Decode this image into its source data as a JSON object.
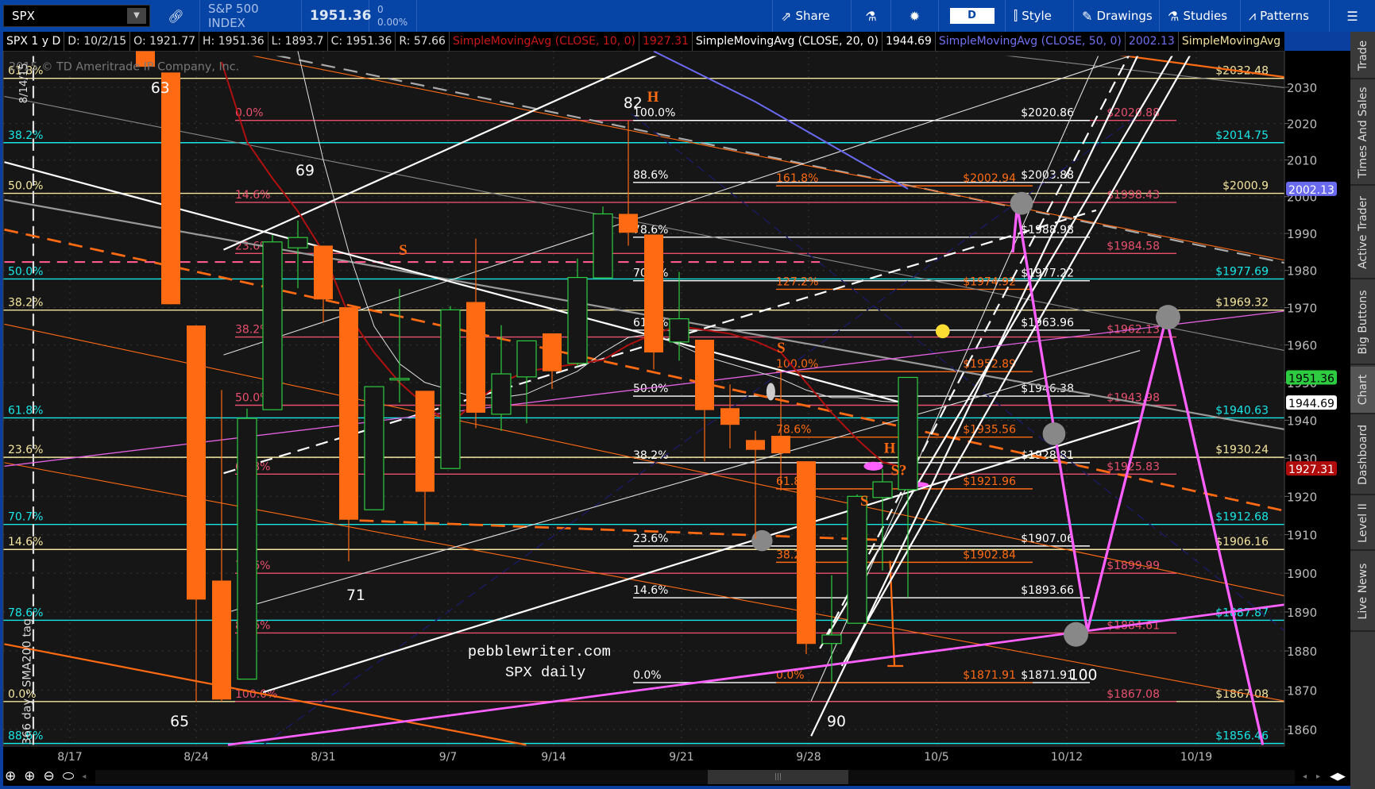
{
  "toolbar": {
    "symbol": "SPX",
    "description": "S&P 500 INDEX",
    "last": "1951.36",
    "change": "0",
    "change_pct": "0.00%",
    "share": "Share",
    "aggregation": "D",
    "style": "Style",
    "drawings": "Drawings",
    "studies": "Studies",
    "patterns": "Patterns"
  },
  "legend": {
    "period": "SPX 1 y D",
    "date": "D: 10/2/15",
    "open": "O: 1921.77",
    "high": "H: 1951.36",
    "low": "L: 1893.7",
    "close": "C: 1951.36",
    "range": "R: 57.66",
    "sma10_label": "SimpleMovingAvg (CLOSE, 10, 0)",
    "sma10_value": "1927.31",
    "sma20_label": "SimpleMovingAvg (CLOSE, 20, 0)",
    "sma20_value": "1944.69",
    "sma50_label": "SimpleMovingAvg (CLOSE, 50, 0)",
    "sma50_value": "2002.13",
    "sma200_label": "SimpleMovingAvg ..."
  },
  "side_tabs": [
    "Trade",
    "Times And Sales",
    "Active Trader",
    "Big Buttons",
    "Chart",
    "Dashboard",
    "Level II",
    "Live News"
  ],
  "colors": {
    "up": "#2ecc40",
    "down": "#ff6a13",
    "sma10": "#b01010",
    "sma20": "#e0e0e0",
    "sma50": "#6a6af0"
  },
  "chart": {
    "copyright": "2015 © TD Ameritrade IP Company, Inc.",
    "vline_date": "8/14/15",
    "vline_note": "366 day - SMA200 tag",
    "watermark1": "pebblewriter.com",
    "watermark2": "SPX daily",
    "price_ticks": [
      1860,
      1870,
      1880,
      1890,
      1900,
      1910,
      1920,
      1930,
      1940,
      1950,
      1960,
      1970,
      1980,
      1990,
      2000,
      2010,
      2020,
      2030
    ],
    "date_labels": [
      "8/17",
      "8/24",
      "8/31",
      "9/7",
      "9/14",
      "9/21",
      "9/28",
      "10/5",
      "10/12",
      "10/19"
    ],
    "price_markers": [
      {
        "value": "2002.13",
        "kind": "sma50"
      },
      {
        "value": "1951.36",
        "kind": "last"
      },
      {
        "value": "1944.69",
        "kind": "sma20"
      },
      {
        "value": "1927.31",
        "kind": "sma10"
      }
    ],
    "candles": [
      {
        "d": "8/20",
        "o": 2095.5,
        "h": 2095.5,
        "l": 2035.7,
        "c": 2035.7
      },
      {
        "d": "8/21",
        "o": 2034.1,
        "h": 2034.1,
        "l": 1970.9,
        "c": 1970.9
      },
      {
        "d": "8/24",
        "o": 1965.2,
        "h": 1965.2,
        "l": 1867.0,
        "c": 1893.2
      },
      {
        "d": "8/25",
        "o": 1898.1,
        "h": 1948.0,
        "l": 1867.1,
        "c": 1867.6
      },
      {
        "d": "8/26",
        "o": 1872.8,
        "h": 1943.1,
        "l": 1872.8,
        "c": 1940.5
      },
      {
        "d": "8/27",
        "o": 1942.8,
        "h": 1989.6,
        "l": 1942.8,
        "c": 1987.7
      },
      {
        "d": "8/28",
        "o": 1986.1,
        "h": 1993.5,
        "l": 1975.2,
        "c": 1988.9
      },
      {
        "d": "8/31",
        "o": 1986.7,
        "h": 1986.7,
        "l": 1966.0,
        "c": 1972.2
      },
      {
        "d": "9/1",
        "o": 1970.1,
        "h": 1970.1,
        "l": 1903.1,
        "c": 1913.9
      },
      {
        "d": "9/2",
        "o": 1916.5,
        "h": 1948.9,
        "l": 1916.5,
        "c": 1948.9
      },
      {
        "d": "9/3",
        "o": 1950.8,
        "h": 1975.0,
        "l": 1944.7,
        "c": 1951.1
      },
      {
        "d": "9/4",
        "o": 1947.8,
        "h": 1947.8,
        "l": 1911.2,
        "c": 1921.2
      },
      {
        "d": "9/8",
        "o": 1927.3,
        "h": 1970.4,
        "l": 1927.3,
        "c": 1969.4
      },
      {
        "d": "9/9",
        "o": 1971.5,
        "h": 1988.6,
        "l": 1937.9,
        "c": 1942.0
      },
      {
        "d": "9/10",
        "o": 1941.6,
        "h": 1965.3,
        "l": 1937.2,
        "c": 1952.3
      },
      {
        "d": "9/11",
        "o": 1951.5,
        "h": 1961.1,
        "l": 1939.2,
        "c": 1961.1
      },
      {
        "d": "9/14",
        "o": 1963.1,
        "h": 1963.1,
        "l": 1948.3,
        "c": 1953.0
      },
      {
        "d": "9/15",
        "o": 1955.1,
        "h": 1983.2,
        "l": 1954.3,
        "c": 1978.1
      },
      {
        "d": "9/16",
        "o": 1978.0,
        "h": 1997.3,
        "l": 1977.9,
        "c": 1995.3
      },
      {
        "d": "9/17",
        "o": 1995.3,
        "h": 2020.9,
        "l": 1986.7,
        "c": 1990.2
      },
      {
        "d": "9/18",
        "o": 1989.7,
        "h": 1989.7,
        "l": 1953.5,
        "c": 1958.0
      },
      {
        "d": "9/21",
        "o": 1960.8,
        "h": 1979.6,
        "l": 1955.8,
        "c": 1967.0
      },
      {
        "d": "9/22",
        "o": 1961.4,
        "h": 1961.4,
        "l": 1929.2,
        "c": 1942.7
      },
      {
        "d": "9/23",
        "o": 1943.2,
        "h": 1949.5,
        "l": 1932.6,
        "c": 1938.8
      },
      {
        "d": "9/24",
        "o": 1934.8,
        "h": 1937.2,
        "l": 1908.9,
        "c": 1932.2
      },
      {
        "d": "9/25",
        "o": 1935.9,
        "h": 1952.9,
        "l": 1921.5,
        "c": 1931.3
      },
      {
        "d": "9/28",
        "o": 1929.2,
        "h": 1929.2,
        "l": 1879.2,
        "c": 1881.8
      },
      {
        "d": "9/29",
        "o": 1881.9,
        "h": 1899.5,
        "l": 1871.9,
        "c": 1884.1
      },
      {
        "d": "9/30",
        "o": 1887.1,
        "h": 1920.5,
        "l": 1887.1,
        "c": 1920.0
      },
      {
        "d": "10/1",
        "o": 1919.7,
        "h": 1927.2,
        "l": 1900.7,
        "c": 1923.8
      },
      {
        "d": "10/2",
        "o": 1921.77,
        "h": 1951.36,
        "l": 1893.7,
        "c": 1951.36
      }
    ],
    "sma10": [
      [
        3,
        2037
      ],
      [
        4,
        2015
      ],
      [
        5,
        2005
      ],
      [
        6,
        1996
      ],
      [
        7,
        1985
      ],
      [
        8,
        1968
      ],
      [
        9,
        1958
      ],
      [
        10,
        1950
      ],
      [
        11,
        1944
      ],
      [
        12,
        1939
      ],
      [
        13,
        1945
      ],
      [
        14,
        1950
      ],
      [
        15,
        1953
      ],
      [
        16,
        1954
      ],
      [
        17,
        1955
      ],
      [
        18,
        1956
      ],
      [
        19,
        1960
      ],
      [
        20,
        1963
      ],
      [
        21,
        1965
      ],
      [
        22,
        1964
      ],
      [
        23,
        1963
      ],
      [
        24,
        1961
      ],
      [
        25,
        1958
      ],
      [
        26,
        1950
      ],
      [
        27,
        1942
      ],
      [
        28,
        1935
      ],
      [
        29,
        1929
      ],
      [
        30,
        1927.31
      ]
    ],
    "sma20": [
      [
        6,
        2040
      ],
      [
        7,
        2010
      ],
      [
        8,
        1985
      ],
      [
        9,
        1965
      ],
      [
        10,
        1955
      ],
      [
        11,
        1950
      ],
      [
        12,
        1948
      ],
      [
        13,
        1946
      ],
      [
        14,
        1946
      ],
      [
        15,
        1947
      ],
      [
        16,
        1950
      ],
      [
        17,
        1953
      ],
      [
        18,
        1958
      ],
      [
        19,
        1962
      ],
      [
        20,
        1963
      ],
      [
        21,
        1960
      ],
      [
        22,
        1957
      ],
      [
        23,
        1955
      ],
      [
        24,
        1953
      ],
      [
        25,
        1951
      ],
      [
        26,
        1948
      ],
      [
        27,
        1946
      ],
      [
        28,
        1946
      ],
      [
        29,
        1945
      ],
      [
        30,
        1944.69
      ]
    ],
    "sma50": [
      [
        20,
        2040
      ],
      [
        22,
        2033
      ],
      [
        24,
        2026
      ],
      [
        26,
        2018
      ],
      [
        28,
        2010
      ],
      [
        30,
        2002.13
      ]
    ],
    "fib_sets": {
      "yellow": [
        [
          "61.8%",
          "$2032.48"
        ],
        [
          "50.0%",
          "$2000.9"
        ],
        [
          "38.2%",
          "$1969.32"
        ],
        [
          "23.6%",
          "$1930.24"
        ],
        [
          "14.6%",
          "$1906.16"
        ],
        [
          "0.0%",
          "$1867.08"
        ]
      ],
      "cyan": [
        [
          "38.2%",
          "$2014.75"
        ],
        [
          "50.0%",
          "$1977.69"
        ],
        [
          "61.8%",
          "$1940.63"
        ],
        [
          "70.7%",
          "$1912.68"
        ],
        [
          "78.6%",
          "$1887.87"
        ],
        [
          "88.6%",
          "$1856.46"
        ]
      ],
      "pink": [
        [
          "0.0%",
          "$2020.88"
        ],
        [
          "14.6%",
          "$1998.43"
        ],
        [
          "23.6%",
          "$1984.58"
        ],
        [
          "38.2%",
          "$1962.13"
        ],
        [
          "50.0%",
          "$1943.98"
        ],
        [
          "61.8%",
          "$1925.83"
        ],
        [
          "78.6%",
          "$1899.99"
        ],
        [
          "88.6%",
          "$1884.61"
        ],
        [
          "100.0%",
          "$1867.08"
        ]
      ],
      "white": [
        [
          "100.0%",
          "$2020.86"
        ],
        [
          "88.6%",
          "$2003.88"
        ],
        [
          "78.6%",
          "$1988.98"
        ],
        [
          "70.7%",
          "$1977.22"
        ],
        [
          "61.8%",
          "$1963.96"
        ],
        [
          "50.0%",
          "$1946.38"
        ],
        [
          "38.2%",
          "$1928.81"
        ],
        [
          "23.6%",
          "$1907.06"
        ],
        [
          "14.6%",
          "$1893.66"
        ],
        [
          "0.0%",
          "$1871.91"
        ]
      ],
      "orange": [
        [
          "161.8%",
          "$2002.94"
        ],
        [
          "127.2%",
          "$1974.92"
        ],
        [
          "100.0%",
          "$1952.89"
        ],
        [
          "78.6%",
          "$1935.56"
        ],
        [
          "61.8%",
          "$1921.96"
        ],
        [
          "38.2%",
          "$1902.84"
        ],
        [
          "0.0%",
          "$1871.91"
        ]
      ]
    },
    "wave_labels": [
      "63",
      "69",
      "71",
      "65",
      "82",
      "90",
      "100"
    ],
    "pattern_labels": [
      "H",
      "S",
      "S",
      "H",
      "S?",
      "S"
    ]
  }
}
